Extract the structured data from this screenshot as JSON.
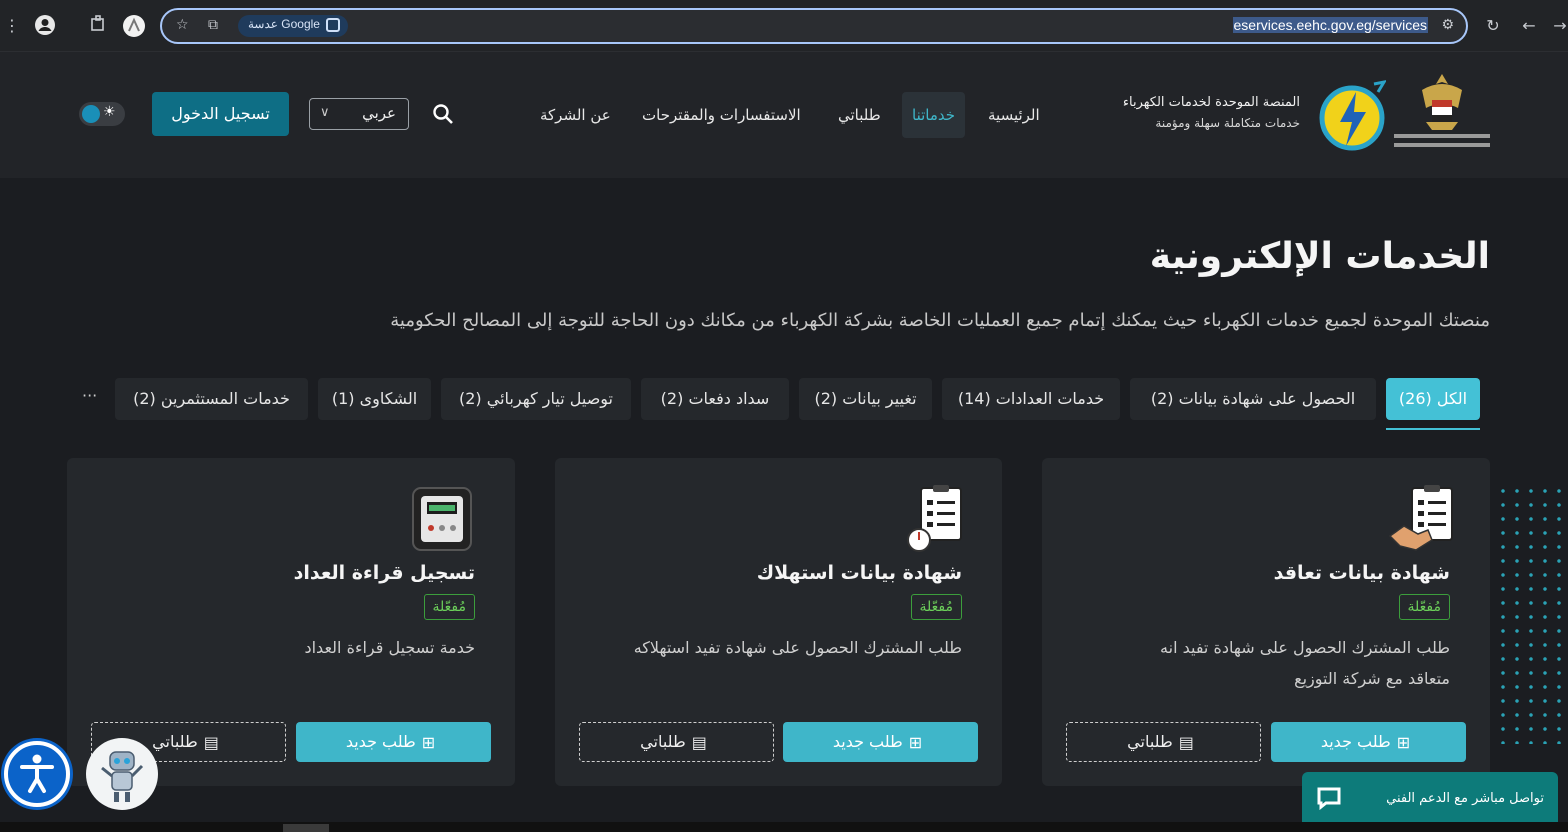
{
  "browser": {
    "url": "eservices.eehc.gov.eg/services",
    "lens_label": "عدسة Google"
  },
  "header": {
    "brand_title": "المنصة الموحدة لخدمات الكهرباء",
    "brand_subtitle": "خدمات متكاملة سهلة ومؤمنة",
    "nav": [
      "الرئيسية",
      "خدماتنا",
      "طلباتي",
      "الاستفسارات والمقترحات",
      "عن الشركة"
    ],
    "language": "عربي",
    "login_label": "تسجيل الدخول"
  },
  "main": {
    "title": "الخدمات الإلكترونية",
    "description": "منصتك الموحدة لجميع خدمات الكهرباء حيث يمكنك إتمام جميع العمليات الخاصة بشركة الكهرباء من مكانك دون الحاجة للتوجة إلى المصالح الحكومية",
    "tabs": [
      "الكل (26)",
      "الحصول على شهادة بيانات (2)",
      "خدمات العدادات (14)",
      "تغيير بيانات (2)",
      "سداد دفعات (2)",
      "توصيل تيار كهربائي (2)",
      "الشكاوى (1)",
      "خدمات المستثمرين (2)"
    ],
    "more": "···",
    "cards": [
      {
        "title": "شهادة بيانات تعاقد",
        "badge": "مُفعّلة",
        "description": "طلب المشترك الحصول على شهادة تفيد انه متعاقد مع شركة التوزيع",
        "new_label": "طلب جديد",
        "mine_label": "طلباتي",
        "icon": "contract-handshake-icon"
      },
      {
        "title": "شهادة بيانات استهلاك",
        "badge": "مُفعّلة",
        "description": "طلب المشترك الحصول على شهادة تفيد استهلاكه",
        "new_label": "طلب جديد",
        "mine_label": "طلباتي",
        "icon": "consumption-report-icon"
      },
      {
        "title": "تسجيل قراءة العداد",
        "badge": "مُفعّلة",
        "description": "خدمة تسجيل قراءة العداد",
        "new_label": "طلب جديد",
        "mine_label": "طلباتي",
        "icon": "electric-meter-icon"
      }
    ]
  },
  "support": {
    "label": "تواصل مباشر مع الدعم الفني"
  },
  "colors": {
    "accent": "#3fb6c9",
    "primary_button": "#0e6e85",
    "active_badge": "#6ccf5a",
    "support_bg": "#0d7b7a"
  }
}
